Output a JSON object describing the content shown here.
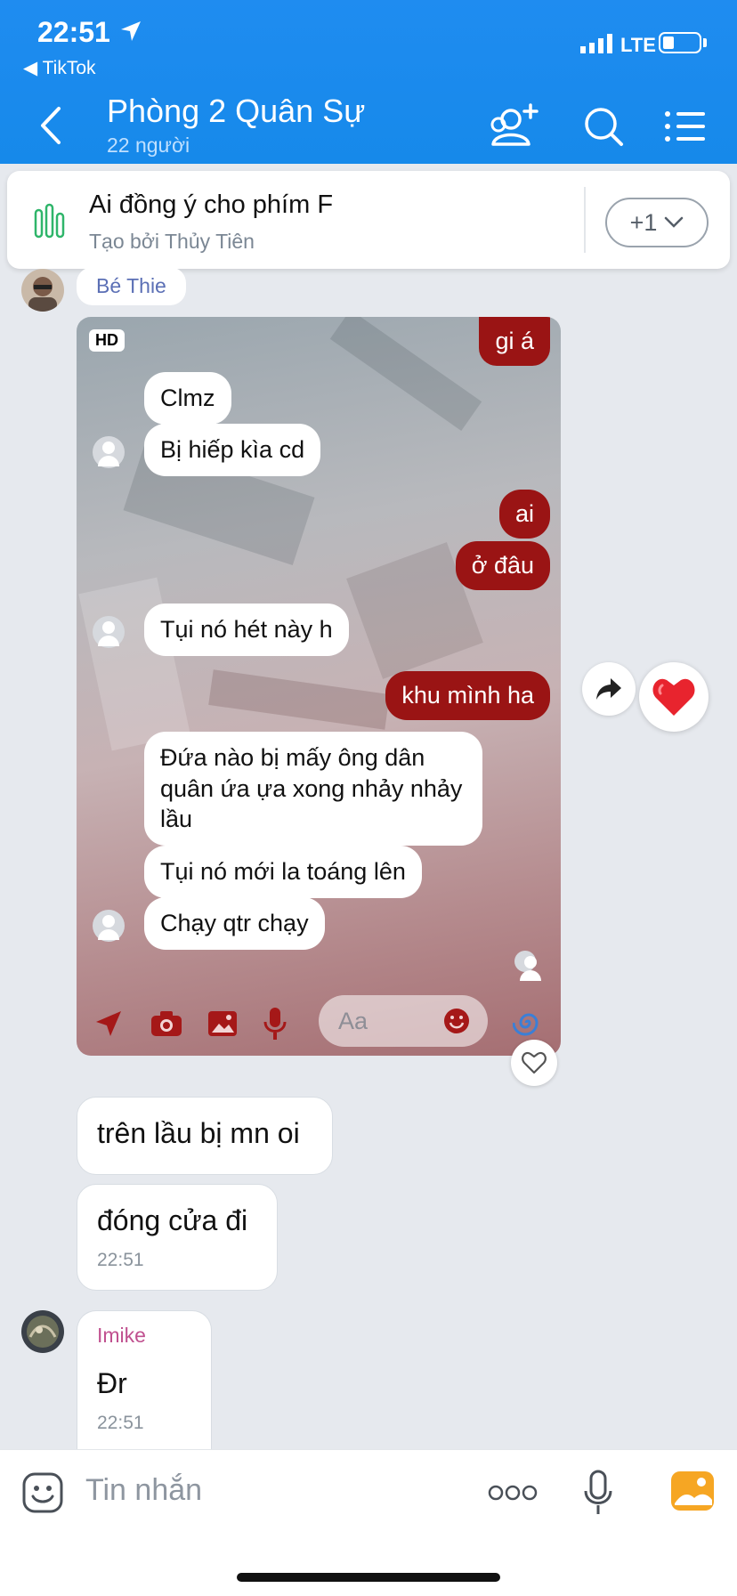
{
  "status_bar": {
    "time": "22:51",
    "back_app": "TikTok",
    "network": "LTE"
  },
  "header": {
    "title": "Phòng 2 Quân Sự",
    "member_count": "22 người"
  },
  "poll": {
    "title": "Ai đồng ý cho phím F",
    "creator": "Tạo bởi Thủy Tiên",
    "more_label": "+1"
  },
  "chat": {
    "first_sender": "Bé Thie",
    "image_message": {
      "badge": "HD",
      "embedded_messages": [
        {
          "side": "out",
          "text": "gi á"
        },
        {
          "side": "in",
          "text": "Clmz"
        },
        {
          "side": "in",
          "text": "Bị hiếp kìa cd"
        },
        {
          "side": "out",
          "text": "ai"
        },
        {
          "side": "out",
          "text": "ở đâu"
        },
        {
          "side": "in",
          "text": "Tụi nó hét này h"
        },
        {
          "side": "out",
          "text": "khu mình ha"
        },
        {
          "side": "in",
          "text": "Đứa nào bị mấy ông dân quân ứa ựa xong nhảy nhảy lầu"
        },
        {
          "side": "in",
          "text": "Tụi nó mới la toáng lên"
        },
        {
          "side": "in",
          "text": "Chạy qtr chạy"
        }
      ],
      "composer_placeholder": "Aa"
    },
    "messages": [
      {
        "text": "trên lầu bị mn oi"
      },
      {
        "text": "đóng cửa đi",
        "time": "22:51"
      }
    ],
    "second_sender": {
      "name": "Imike",
      "text": "Đr",
      "time": "22:51"
    }
  },
  "input": {
    "placeholder": "Tin nhắn"
  },
  "colors": {
    "header_blue": "#1f8cf0",
    "sender_blue": "#5b6fb5",
    "sender_pink": "#c0508f",
    "outgoing_red": "#9a1414"
  }
}
